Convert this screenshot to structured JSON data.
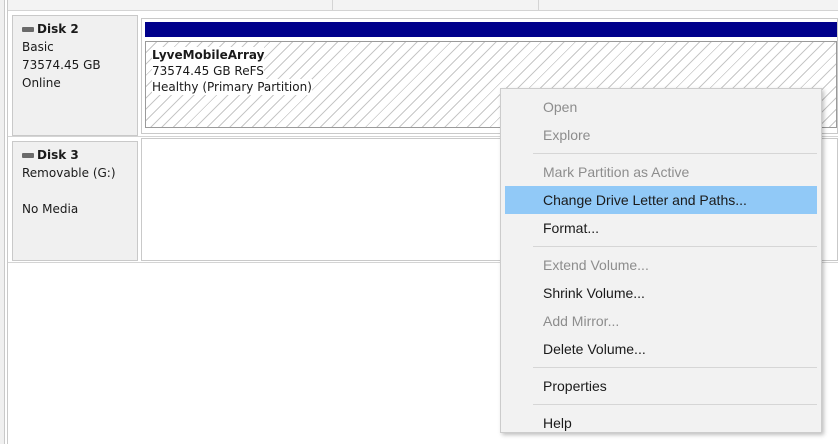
{
  "disks": [
    {
      "name": "Disk 2",
      "lines": [
        "Basic",
        "73574.45 GB",
        "Online"
      ]
    },
    {
      "name": "Disk 3",
      "lines": [
        "Removable (G:)",
        "",
        "No Media"
      ]
    }
  ],
  "volume": {
    "name": "LyveMobileArray",
    "size_fs": "73574.45 GB ReFS",
    "status": "Healthy (Primary Partition)",
    "header_color": "#00008b"
  },
  "context_menu": {
    "highlight_color": "#91c9f7",
    "groups": [
      [
        {
          "label": "Open",
          "enabled": false
        },
        {
          "label": "Explore",
          "enabled": false
        }
      ],
      [
        {
          "label": "Mark Partition as Active",
          "enabled": false
        },
        {
          "label": "Change Drive Letter and Paths...",
          "enabled": true,
          "highlighted": true
        },
        {
          "label": "Format...",
          "enabled": true
        }
      ],
      [
        {
          "label": "Extend Volume...",
          "enabled": false
        },
        {
          "label": "Shrink Volume...",
          "enabled": true
        },
        {
          "label": "Add Mirror...",
          "enabled": false
        },
        {
          "label": "Delete Volume...",
          "enabled": true
        }
      ],
      [
        {
          "label": "Properties",
          "enabled": true
        }
      ],
      [
        {
          "label": "Help",
          "enabled": true
        }
      ]
    ]
  }
}
